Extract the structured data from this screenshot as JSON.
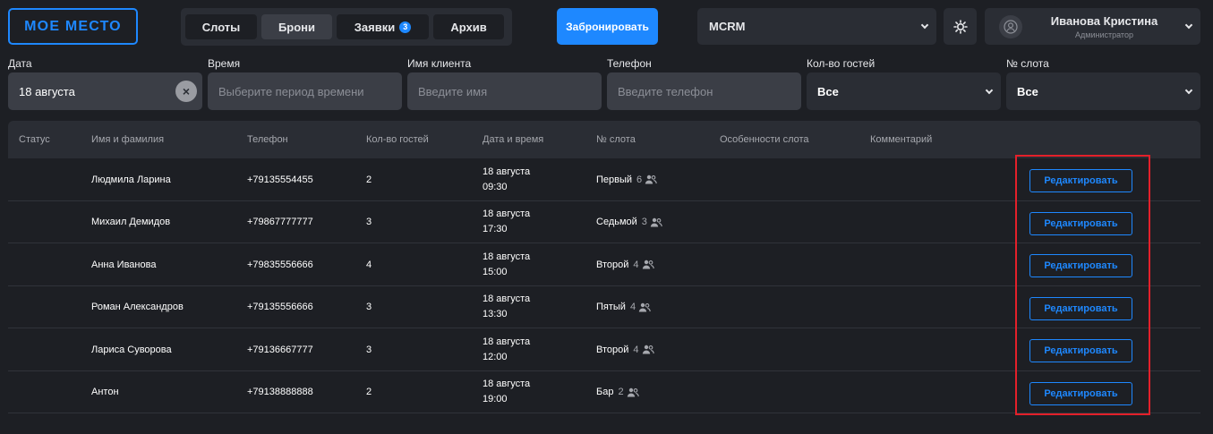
{
  "header": {
    "logo": "МОЕ МЕСТО",
    "tabs": [
      {
        "label": "Слоты",
        "badge": null
      },
      {
        "label": "Брони",
        "badge": null
      },
      {
        "label": "Заявки",
        "badge": "3"
      },
      {
        "label": "Архив",
        "badge": null
      }
    ],
    "active_tab": "Брони",
    "book_button": "Забронировать",
    "venue_select": "MCRM",
    "user": {
      "name": "Иванова Кристина",
      "role": "Администратор"
    }
  },
  "filters": {
    "date": {
      "label": "Дата",
      "value": "18 августа"
    },
    "time": {
      "label": "Время",
      "placeholder": "Выберите период времени"
    },
    "client": {
      "label": "Имя клиента",
      "placeholder": "Введите имя"
    },
    "phone": {
      "label": "Телефон",
      "placeholder": "Введите телефон"
    },
    "guests": {
      "label": "Кол-во гостей",
      "value": "Все"
    },
    "slot": {
      "label": "№ слота",
      "value": "Все"
    }
  },
  "table": {
    "columns": [
      "Статус",
      "Имя и фамилия",
      "Телефон",
      "Кол-во гостей",
      "Дата и время",
      "№ слота",
      "Особенности слота",
      "Комментарий"
    ],
    "edit_label": "Редактировать",
    "rows": [
      {
        "name": "Людмила Ларина",
        "phone": "+79135554455",
        "guests": "2",
        "date": "18 августа",
        "time": "09:30",
        "slot": "Первый",
        "capacity": "6"
      },
      {
        "name": "Михаил Демидов",
        "phone": "+79867777777",
        "guests": "3",
        "date": "18 августа",
        "time": "17:30",
        "slot": "Седьмой",
        "capacity": "3"
      },
      {
        "name": "Анна Иванова",
        "phone": "+79835556666",
        "guests": "4",
        "date": "18 августа",
        "time": "15:00",
        "slot": "Второй",
        "capacity": "4"
      },
      {
        "name": "Роман Александров",
        "phone": "+79135556666",
        "guests": "3",
        "date": "18 августа",
        "time": "13:30",
        "slot": "Пятый",
        "capacity": "4"
      },
      {
        "name": "Лариса Суворова",
        "phone": "+79136667777",
        "guests": "3",
        "date": "18 августа",
        "time": "12:00",
        "slot": "Второй",
        "capacity": "4"
      },
      {
        "name": "Антон",
        "phone": "+79138888888",
        "guests": "2",
        "date": "18 августа",
        "time": "19:00",
        "slot": "Бар",
        "capacity": "2"
      }
    ]
  },
  "colors": {
    "accent": "#1e88ff",
    "background": "#1d1f24",
    "panel": "#2a2d34",
    "highlight": "#e3202a"
  },
  "icons": {
    "theme": "sun-gear-icon",
    "avatar": "user-avatar-icon",
    "guests": "people-icon",
    "clear": "close-icon",
    "dropdown": "chevron-down-icon"
  }
}
